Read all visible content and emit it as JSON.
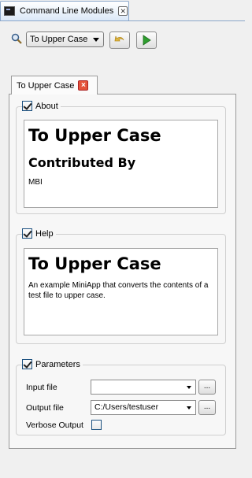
{
  "window": {
    "tab_title": "Command Line Modules"
  },
  "toolbar": {
    "module_select": "To Upper Case",
    "icons": {
      "search": "search-icon",
      "undo": "undo-icon",
      "run": "run-icon"
    }
  },
  "module_tab": {
    "label": "To Upper Case"
  },
  "about": {
    "title": "About",
    "heading": "To Upper Case",
    "contributed_heading": "Contributed By",
    "contributor": "MBI"
  },
  "help": {
    "title": "Help",
    "heading": "To Upper Case",
    "text": "An example MiniApp that converts the contents of a test file to upper case."
  },
  "parameters": {
    "title": "Parameters",
    "input_label": "Input file",
    "input_value": "",
    "output_label": "Output file",
    "output_value": "C:/Users/testuser",
    "verbose_label": "Verbose Output",
    "browse_label": "...",
    "verbose_checked": false
  },
  "colors": {
    "tab_border": "#8aa6c9",
    "close_red": "#e4533b",
    "run_green": "#2e9e2e",
    "undo_yellow": "#e0b844"
  }
}
